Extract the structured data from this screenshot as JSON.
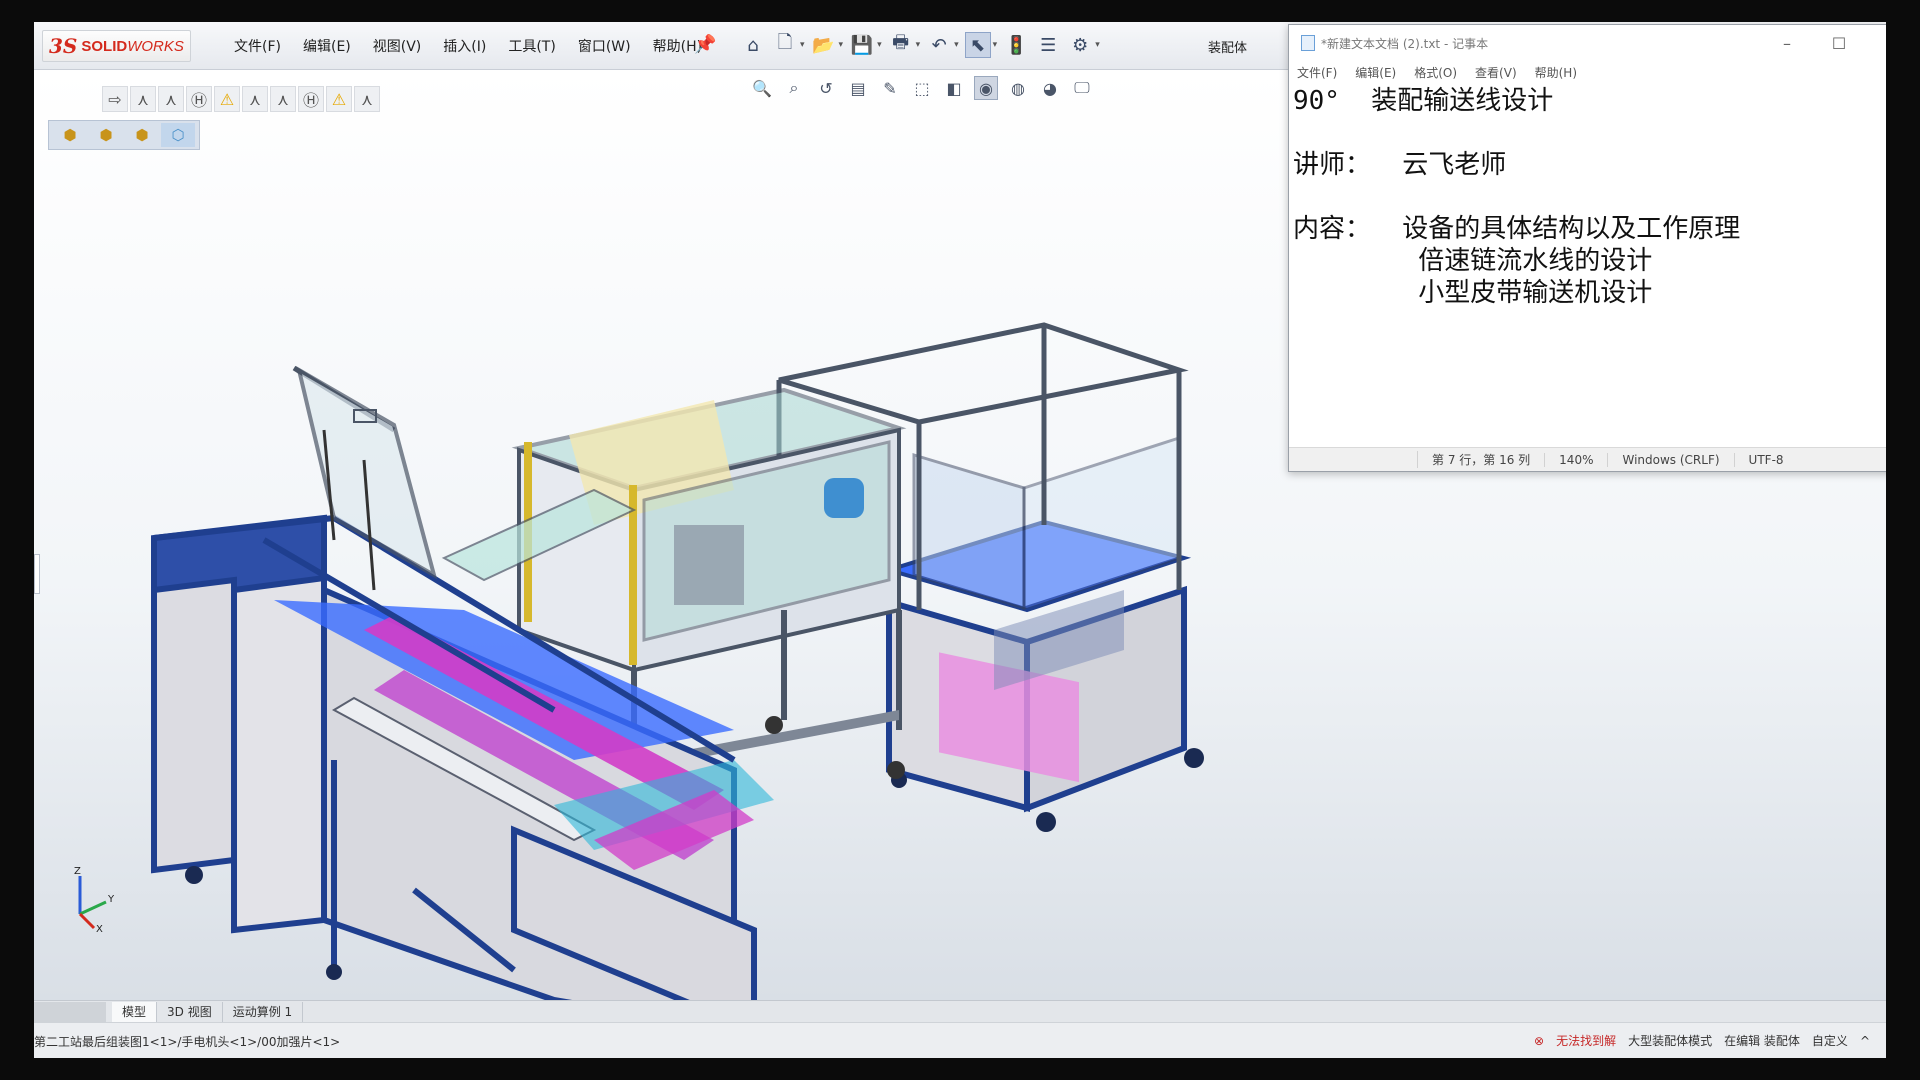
{
  "app": {
    "logo_mark": "3S",
    "logo_text_bold": "SOLID",
    "logo_text_light": "WORKS",
    "menu": [
      "文件(F)",
      "编辑(E)",
      "视图(V)",
      "插入(I)",
      "工具(T)",
      "窗口(W)",
      "帮助(H)"
    ],
    "document_label": "装配体"
  },
  "toolbar_icons": [
    "home-icon",
    "new-document-icon",
    "open-icon",
    "save-icon",
    "print-icon",
    "undo-icon",
    "select-icon",
    "traffic-light-icon",
    "file-properties-icon",
    "options-gear-icon"
  ],
  "tabs": [
    "模型",
    "3D 视图",
    "运动算例 1"
  ],
  "status": {
    "path": "第二工站最后组装图1<1>/手电机头<1>/00加强片<1>",
    "error": "无法找到解",
    "mode": "大型装配体模式",
    "editing": "在编辑 装配体",
    "custom": "自定义",
    "arrow": "^"
  },
  "notepad": {
    "title": "*新建文本文档 (2).txt - 记事本",
    "menu": [
      "文件(F)",
      "编辑(E)",
      "格式(O)",
      "查看(V)",
      "帮助(H)"
    ],
    "content": "90°  装配输送线设计\n\n讲师：  云飞老师\n\n内容：  设备的具体结构以及工作原理\n        倍速链流水线的设计\n        小型皮带输送机设计",
    "status_position": "第 7 行，第 16 列",
    "status_zoom": "140%",
    "status_eol": "Windows (CRLF)",
    "status_encoding": "UTF-8",
    "controls": [
      "–",
      "☐",
      "✕"
    ]
  },
  "triad": {
    "z": "Z",
    "x": "X",
    "y": "Y"
  },
  "colors": {
    "frame": "#1f3f8f",
    "panel": "#c9c9cf",
    "magenta": "#d23cc8",
    "cyan": "#2fb7d9",
    "glass": "#a8d7d2"
  }
}
